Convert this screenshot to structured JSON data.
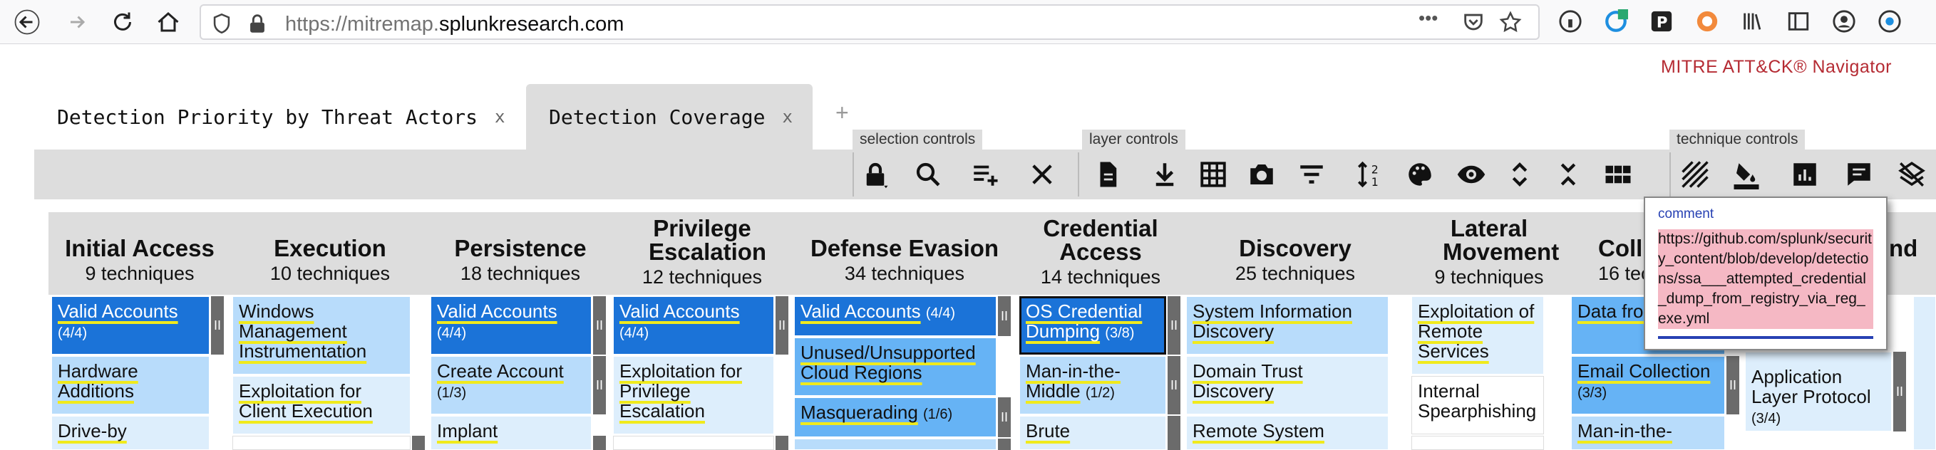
{
  "browser": {
    "url_prefix": "https://",
    "url_host_a": "mitremap.",
    "url_host_b": "splunkresearch.com",
    "more_dots": "•••"
  },
  "navigator": {
    "title": "MITRE ATT&CK® Navigator",
    "tabs": [
      {
        "label": "Detection Priority by Threat Actors",
        "close": "x"
      },
      {
        "label": "Detection Coverage",
        "close": "x"
      }
    ],
    "add_tab": "+",
    "control_groups": {
      "selection": "selection controls",
      "layer": "layer controls",
      "technique": "technique controls"
    }
  },
  "tactics": [
    {
      "name": "Initial Access",
      "count": "9 techniques"
    },
    {
      "name": "Execution",
      "count": "10 techniques"
    },
    {
      "name": "Persistence",
      "count": "18 techniques"
    },
    {
      "name": "Privilege Escalation",
      "count": "12 techniques"
    },
    {
      "name": "Defense Evasion",
      "count": "34 techniques"
    },
    {
      "name": "Credential Access",
      "count": "14 techniques"
    },
    {
      "name": "Discovery",
      "count": "25 techniques"
    },
    {
      "name": "Lateral Movement",
      "count": "9 techniques"
    },
    {
      "name": "Coll",
      "count": "16 tec"
    },
    {
      "name": "nd",
      "count": ""
    }
  ],
  "techniques": {
    "initial_access": [
      {
        "name": "Valid Accounts",
        "count": "(4/4)"
      },
      {
        "name": "Hardware Additions",
        "count": ""
      },
      {
        "name": "Drive-by",
        "count": ""
      }
    ],
    "execution": [
      {
        "name": "Windows Management Instrumentation",
        "count": ""
      },
      {
        "name": "Exploitation for Client Execution",
        "count": ""
      }
    ],
    "persistence": [
      {
        "name": "Valid Accounts",
        "count": "(4/4)"
      },
      {
        "name": "Create Account",
        "count": "(1/3)"
      },
      {
        "name": "Implant",
        "count": ""
      }
    ],
    "privilege_escalation": [
      {
        "name": "Valid Accounts",
        "count": "(4/4)"
      },
      {
        "name": "Exploitation for Privilege Escalation",
        "count": ""
      }
    ],
    "defense_evasion": [
      {
        "name": "Valid Accounts",
        "count": "(4/4)"
      },
      {
        "name": "Unused/Unsupported Cloud Regions",
        "count": ""
      },
      {
        "name": "Masquerading",
        "count": "(1/6)"
      }
    ],
    "credential_access": [
      {
        "name": "OS Credential Dumping",
        "count": "(3/8)"
      },
      {
        "name": "Man-in-the-Middle",
        "count": "(1/2)"
      },
      {
        "name": "Brute",
        "count": ""
      }
    ],
    "discovery": [
      {
        "name": "System Information Discovery",
        "count": ""
      },
      {
        "name": "Domain Trust Discovery",
        "count": ""
      },
      {
        "name": "Remote System",
        "count": ""
      }
    ],
    "lateral_movement": [
      {
        "name": "Exploitation of Remote Services",
        "count": ""
      },
      {
        "name": "Internal Spearphishing",
        "count": ""
      }
    ],
    "collection": [
      {
        "name": "Data fro Storage",
        "count": ""
      },
      {
        "name": "Email Collection",
        "count": "(3/3)"
      },
      {
        "name": "Man-in-the-",
        "count": ""
      }
    ],
    "command_and_control": [
      {
        "name": "Application Layer Protocol",
        "count": "(3/4)"
      }
    ]
  },
  "tooltip": {
    "label": "comment",
    "text": "https://github.com/splunk/security_content/blob/develop/detections/ssa___attempted_credential_dump_from_registry_via_reg_exe.yml"
  },
  "colors": {
    "score_high": "#1b73d8",
    "score_mid": "#66b3f5",
    "score_low": "#b8dcfb",
    "score_min": "#ddeefc",
    "comment_underline": "#f0ea1c",
    "title_red": "#b52b33"
  }
}
